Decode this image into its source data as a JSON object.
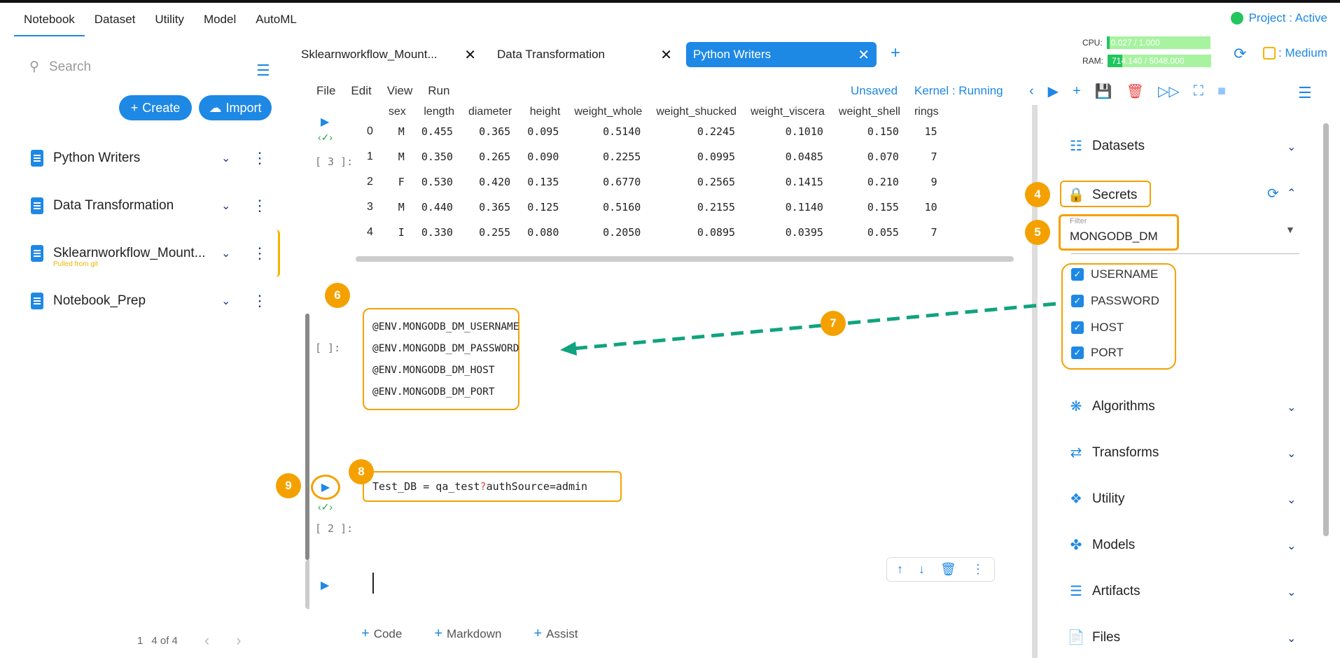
{
  "topnav": {
    "items": [
      "Notebook",
      "Dataset",
      "Utility",
      "Model",
      "AutoML"
    ]
  },
  "project_status": "Project : Active",
  "sidebar": {
    "search_placeholder": "Search",
    "create_label": "Create",
    "import_label": "Import",
    "notebooks": [
      {
        "name": "Python Writers",
        "sub": ""
      },
      {
        "name": "Data Transformation",
        "sub": ""
      },
      {
        "name": "Sklearnworkflow_Mount...",
        "sub": "Pulled from git"
      },
      {
        "name": "Notebook_Prep",
        "sub": ""
      }
    ],
    "pager": {
      "page": "1",
      "range": "4 of 4"
    }
  },
  "tabs": [
    "Sklearnworkflow_Mount...",
    "Data Transformation",
    "Python Writers"
  ],
  "resources": {
    "cpu_label": "CPU:",
    "cpu_value": "0.027 / 1.000",
    "ram_label": "RAM:",
    "ram_value": "714.140 / 5048.000",
    "size": ": Medium"
  },
  "menubar": {
    "file": "File",
    "edit": "Edit",
    "view": "View",
    "run": "Run",
    "unsaved": "Unsaved",
    "kernel": "Kernel : Running"
  },
  "dataframe": {
    "columns": [
      "",
      "sex",
      "length",
      "diameter",
      "height",
      "weight_whole",
      "weight_shucked",
      "weight_viscera",
      "weight_shell",
      "rings"
    ],
    "rows": [
      [
        "0",
        "M",
        "0.455",
        "0.365",
        "0.095",
        "0.5140",
        "0.2245",
        "0.1010",
        "0.150",
        "15"
      ],
      [
        "1",
        "M",
        "0.350",
        "0.265",
        "0.090",
        "0.2255",
        "0.0995",
        "0.0485",
        "0.070",
        "7"
      ],
      [
        "2",
        "F",
        "0.530",
        "0.420",
        "0.135",
        "0.6770",
        "0.2565",
        "0.1415",
        "0.210",
        "9"
      ],
      [
        "3",
        "M",
        "0.440",
        "0.365",
        "0.125",
        "0.5160",
        "0.2155",
        "0.1140",
        "0.155",
        "10"
      ],
      [
        "4",
        "I",
        "0.330",
        "0.255",
        "0.080",
        "0.2050",
        "0.0895",
        "0.0395",
        "0.055",
        "7"
      ]
    ],
    "count": "[ 3 ]:"
  },
  "env_cell": {
    "count": "[    ]:",
    "lines": [
      "@ENV.MONGODB_DM_USERNAME",
      "@ENV.MONGODB_DM_PASSWORD",
      "@ENV.MONGODB_DM_HOST",
      "@ENV.MONGODB_DM_PORT"
    ]
  },
  "code_cell": {
    "pre": "Test_DB = qa_test",
    "q": "?",
    "post": "authSource=admin",
    "count": "[ 2 ]:"
  },
  "add_row": {
    "code": "Code",
    "markdown": "Markdown",
    "assist": "Assist"
  },
  "right_panel": {
    "datasets": "Datasets",
    "secrets": "Secrets",
    "filter_label": "Filter",
    "filter_value": "MONGODB_DM",
    "checks": [
      "USERNAME",
      "PASSWORD",
      "HOST",
      "PORT"
    ],
    "algorithms": "Algorithms",
    "transforms": "Transforms",
    "utility": "Utility",
    "models": "Models",
    "artifacts": "Artifacts",
    "files": "Files"
  },
  "badges": [
    "4",
    "5",
    "6",
    "7",
    "8",
    "9"
  ],
  "colors": {
    "accent": "#1e88e5",
    "callout": "#f4a100",
    "arrow": "#10a37f",
    "active_dot": "#22c55e"
  }
}
